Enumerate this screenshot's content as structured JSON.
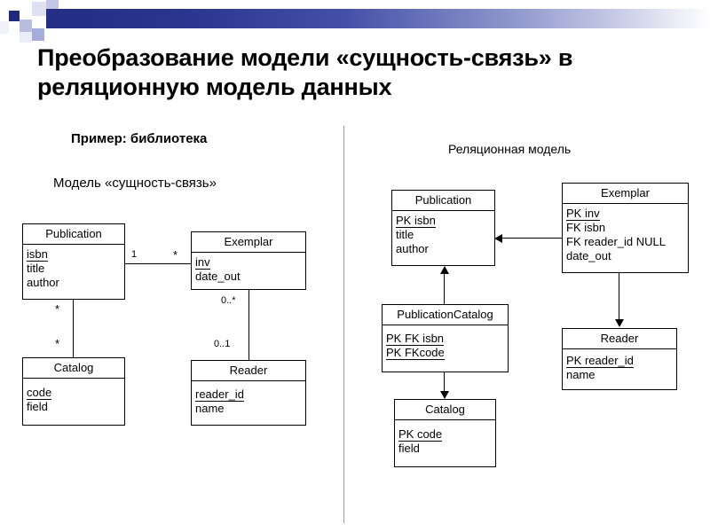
{
  "slide": {
    "title": "Преобразование модели «сущность-связь» в реляционную модель данных",
    "accent_color": "#252f86",
    "background_color": "#ffffff",
    "line_color": "#000000"
  },
  "left_panel": {
    "caption_example": "Пример: библиотека",
    "caption_model": "Модель «сущность-связь»",
    "entities": [
      {
        "name": "Publication",
        "attributes": [
          {
            "text": "isbn",
            "underlined": true
          },
          {
            "text": "title",
            "underlined": false
          },
          {
            "text": "author",
            "underlined": false
          }
        ]
      },
      {
        "name": "Exemplar",
        "attributes": [
          {
            "text": "inv",
            "underlined": true
          },
          {
            "text": "date_out",
            "underlined": false
          }
        ]
      },
      {
        "name": "Catalog",
        "attributes": [
          {
            "text": "code",
            "underlined": true
          },
          {
            "text": "field",
            "underlined": false
          }
        ]
      },
      {
        "name": "Reader",
        "attributes": [
          {
            "text": "reader_id",
            "underlined": true
          },
          {
            "text": "name",
            "underlined": false
          }
        ]
      }
    ],
    "multiplicities": {
      "pub_to_exemplar_near": "1",
      "pub_to_exemplar_far": "*",
      "pub_to_catalog_near": "*",
      "pub_to_catalog_far": "*",
      "exemplar_to_reader_near": "0..*",
      "exemplar_to_reader_far": "0..1"
    }
  },
  "right_panel": {
    "caption": "Реляционная модель",
    "relations": [
      {
        "name": "Publication",
        "attributes": [
          {
            "text": "PK isbn",
            "underlined": true
          },
          {
            "text": "title",
            "underlined": false
          },
          {
            "text": "author",
            "underlined": false
          }
        ]
      },
      {
        "name": "Exemplar",
        "attributes": [
          {
            "text": "PK inv",
            "underlined": true
          },
          {
            "text": "FK isbn",
            "underlined": false
          },
          {
            "text": "FK reader_id NULL",
            "underlined": false
          },
          {
            "text": "date_out",
            "underlined": false
          }
        ]
      },
      {
        "name": "PublicationCatalog",
        "attributes": [
          {
            "text": "PK FK isbn",
            "underlined": true
          },
          {
            "text": "PK FKcode",
            "underlined": true
          }
        ]
      },
      {
        "name": "Catalog",
        "attributes": [
          {
            "text": "PK code",
            "underlined": true
          },
          {
            "text": "field",
            "underlined": false
          }
        ]
      },
      {
        "name": "Reader",
        "attributes": [
          {
            "text": "PK reader_id",
            "underlined": true
          },
          {
            "text": "name",
            "underlined": false
          }
        ]
      }
    ]
  }
}
